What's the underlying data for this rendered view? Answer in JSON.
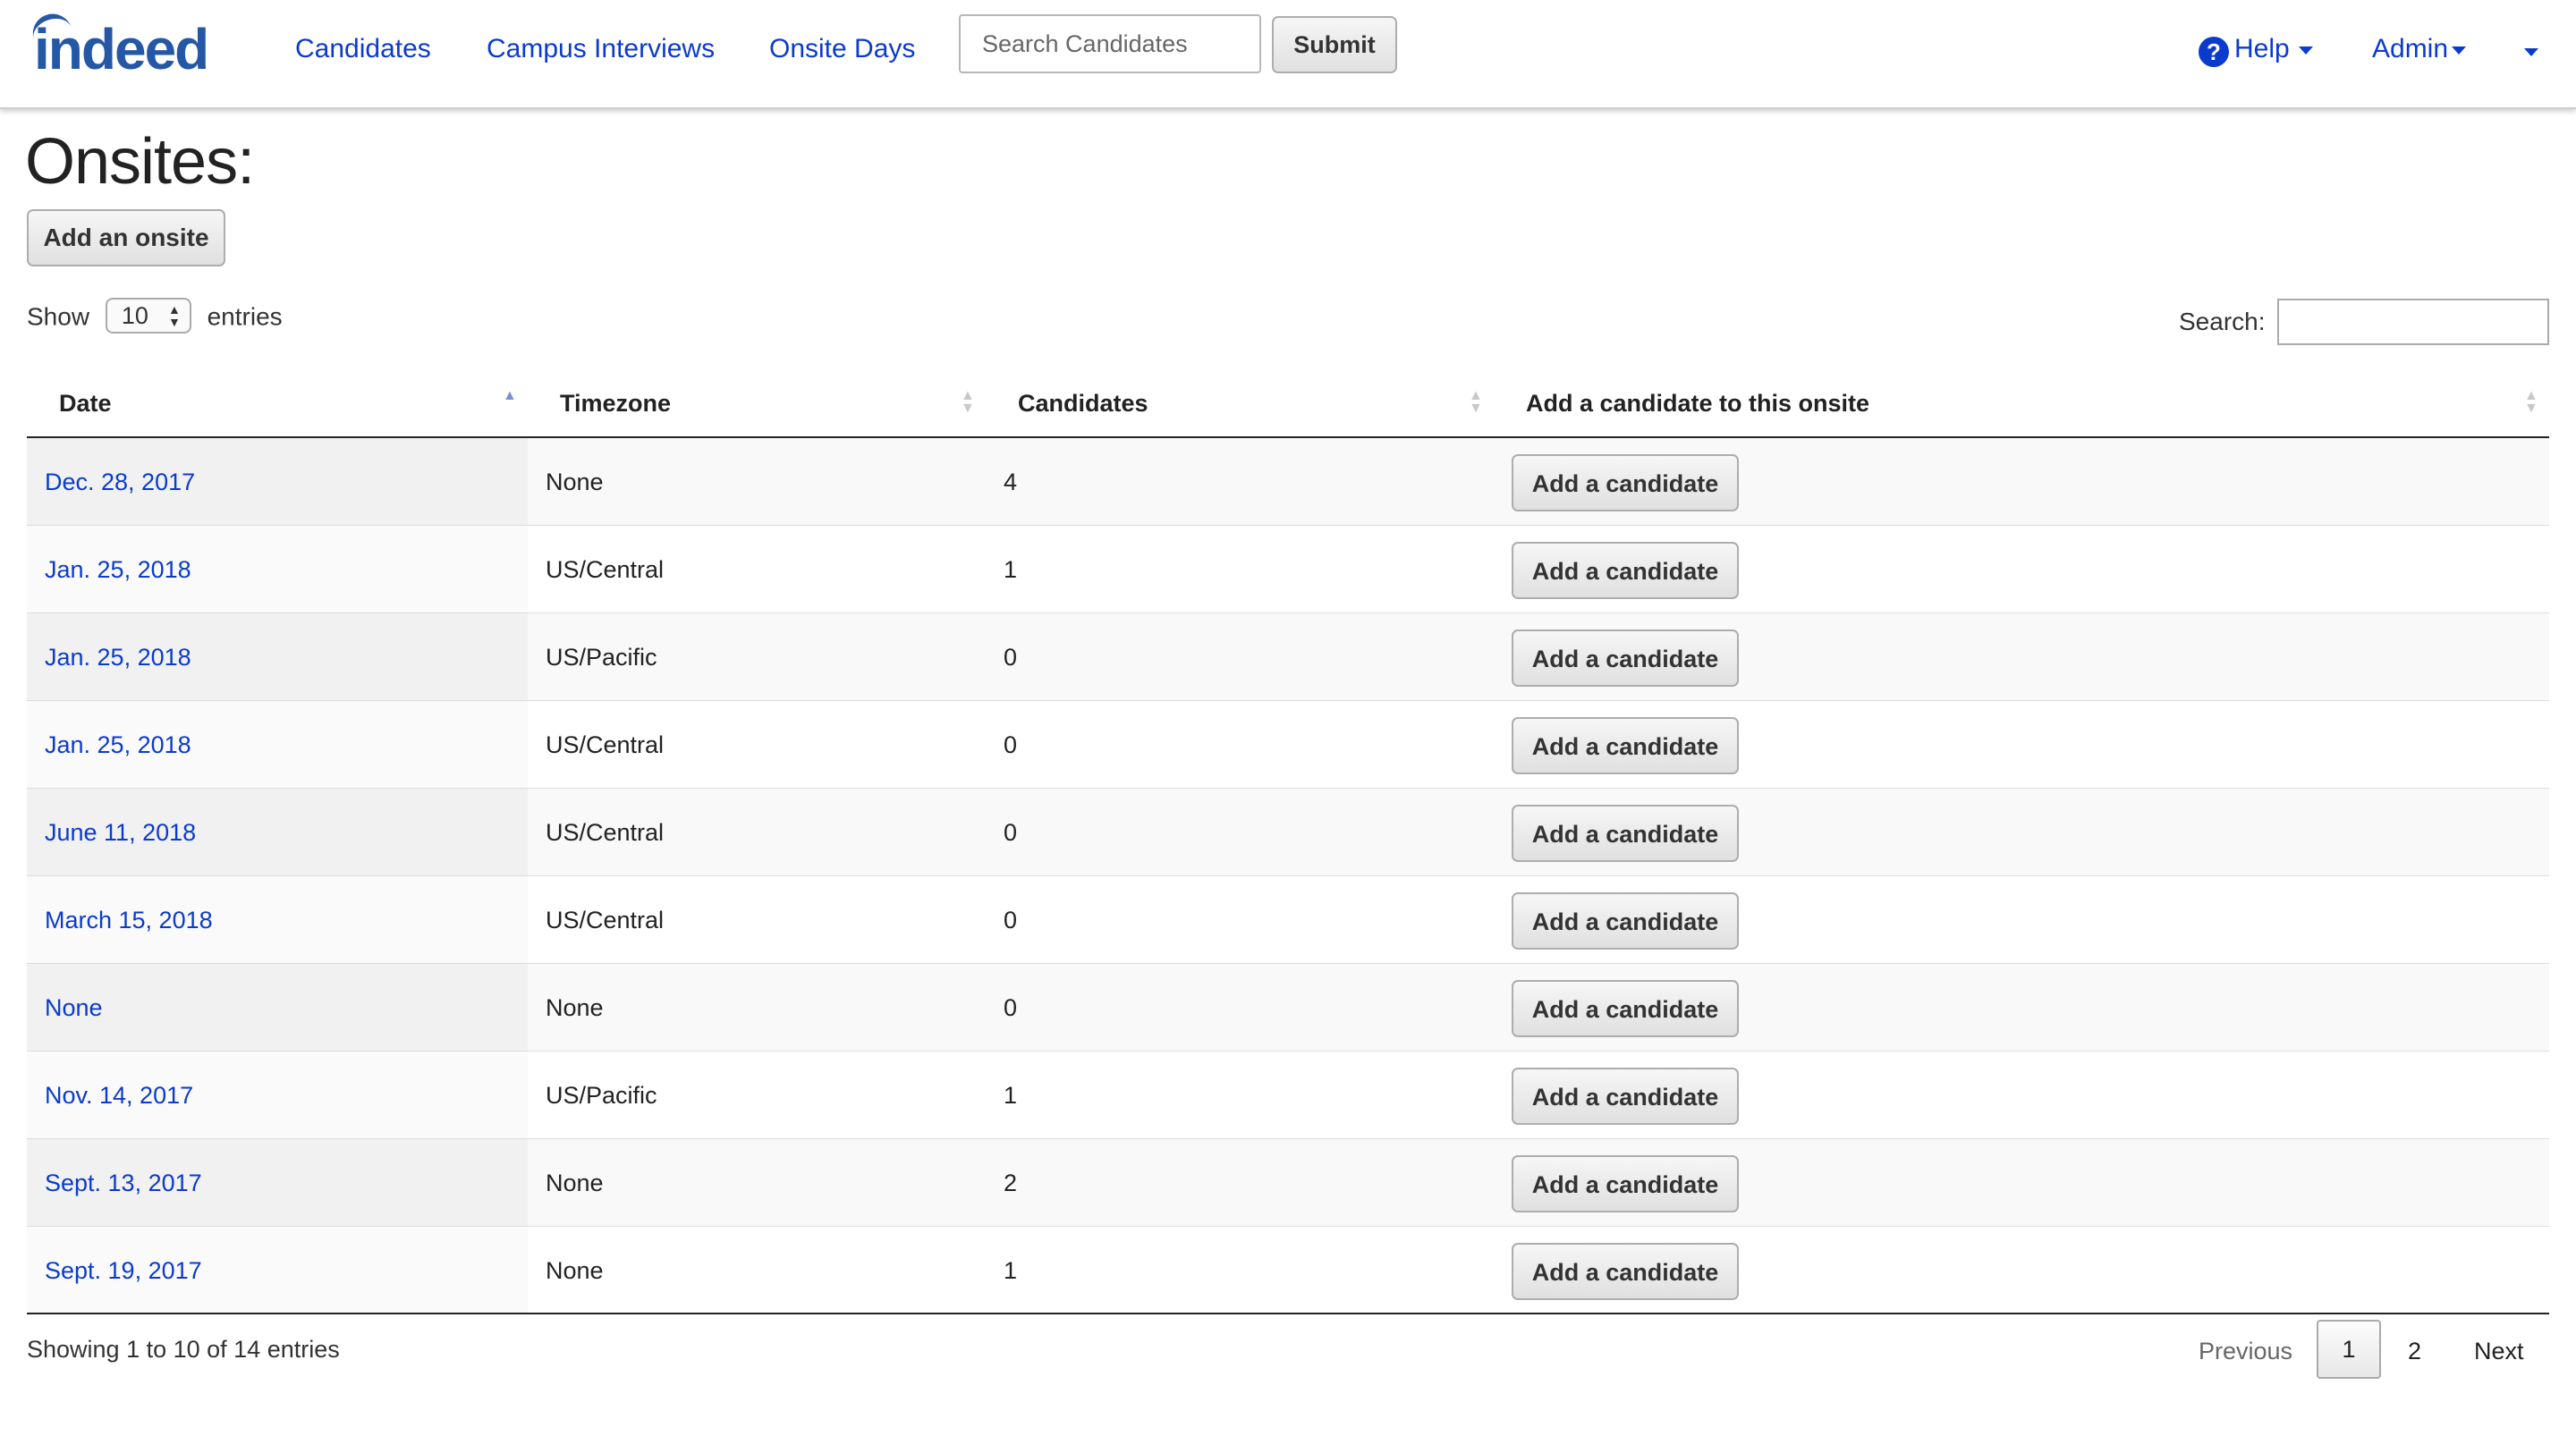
{
  "nav": {
    "logo": "indeed",
    "links": [
      "Candidates",
      "Campus Interviews",
      "Onsite Days"
    ],
    "search_placeholder": "Search Candidates",
    "submit_label": "Submit",
    "help_label": "Help",
    "admin_label": "Admin"
  },
  "page": {
    "title": "Onsites:",
    "add_onsite_label": "Add an onsite"
  },
  "table_controls": {
    "show_label": "Show",
    "entries_label": "entries",
    "page_length": "10",
    "search_label": "Search:"
  },
  "columns": [
    "Date",
    "Timezone",
    "Candidates",
    "Add a candidate to this onsite"
  ],
  "sorted_column": "Date",
  "sort_direction": "ascending",
  "rows": [
    {
      "date": "Dec. 28, 2017",
      "timezone": "None",
      "candidates": "4",
      "action": "Add a candidate"
    },
    {
      "date": "Jan. 25, 2018",
      "timezone": "US/Central",
      "candidates": "1",
      "action": "Add a candidate"
    },
    {
      "date": "Jan. 25, 2018",
      "timezone": "US/Pacific",
      "candidates": "0",
      "action": "Add a candidate"
    },
    {
      "date": "Jan. 25, 2018",
      "timezone": "US/Central",
      "candidates": "0",
      "action": "Add a candidate"
    },
    {
      "date": "June 11, 2018",
      "timezone": "US/Central",
      "candidates": "0",
      "action": "Add a candidate"
    },
    {
      "date": "March 15, 2018",
      "timezone": "US/Central",
      "candidates": "0",
      "action": "Add a candidate"
    },
    {
      "date": "None",
      "timezone": "None",
      "candidates": "0",
      "action": "Add a candidate"
    },
    {
      "date": "Nov. 14, 2017",
      "timezone": "US/Pacific",
      "candidates": "1",
      "action": "Add a candidate"
    },
    {
      "date": "Sept. 13, 2017",
      "timezone": "None",
      "candidates": "2",
      "action": "Add a candidate"
    },
    {
      "date": "Sept. 19, 2017",
      "timezone": "None",
      "candidates": "1",
      "action": "Add a candidate"
    }
  ],
  "footer": {
    "info": "Showing 1 to 10 of 14 entries",
    "previous": "Previous",
    "pages": [
      "1",
      "2"
    ],
    "current_page": "1",
    "next": "Next"
  },
  "colors": {
    "link": "#0b3bcc",
    "logo": "#2557a7"
  }
}
